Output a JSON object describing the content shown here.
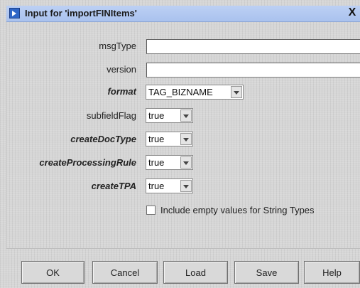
{
  "dialog": {
    "title": "Input for 'importFINItems'",
    "close_glyph": "X",
    "icon": "dialog-app-icon"
  },
  "form": {
    "fields": [
      {
        "label": "msgType",
        "value": "",
        "type": "text"
      },
      {
        "label": "version",
        "value": "",
        "type": "text"
      },
      {
        "label": "format",
        "value": "TAG_BIZNAME",
        "type": "select"
      },
      {
        "label": "subfieldFlag",
        "value": "true",
        "type": "select"
      },
      {
        "label": "createDocType",
        "value": "true",
        "type": "select"
      },
      {
        "label": "createProcessingRule",
        "value": "true",
        "type": "select"
      },
      {
        "label": "createTPA",
        "value": "true",
        "type": "select"
      }
    ],
    "include_empty": {
      "label": "Include empty values for String Types",
      "checked": false
    }
  },
  "buttons": {
    "ok": "OK",
    "cancel": "Cancel",
    "load": "Load",
    "save": "Save",
    "help": "Help"
  }
}
